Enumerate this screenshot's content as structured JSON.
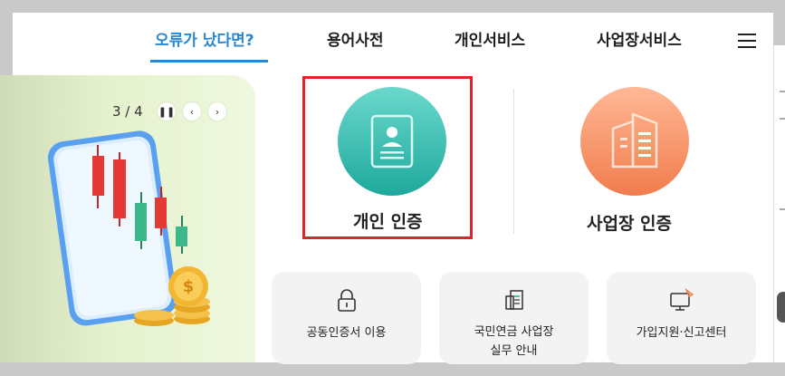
{
  "nav": {
    "items": [
      {
        "label": "오류가 났다면?",
        "active": true
      },
      {
        "label": "용어사전",
        "active": false
      },
      {
        "label": "개인서비스",
        "active": false
      },
      {
        "label": "사업장서비스",
        "active": false
      }
    ],
    "menu_icon": "hamburger-menu-icon"
  },
  "banner": {
    "pager": "3 / 4",
    "controls": [
      "pause-icon",
      "chevron-left-icon",
      "chevron-right-icon"
    ]
  },
  "auth": {
    "personal_label": "개인 인증",
    "business_label": "사업장 인증",
    "personal_icon": "id-card-icon",
    "business_icon": "building-icon"
  },
  "cards": [
    {
      "label": "공동인증서 이용",
      "icon": "lock-icon"
    },
    {
      "label_line1": "국민연금 사업장",
      "label_line2": "실무 안내",
      "icon": "document-icon"
    },
    {
      "label": "가입지원·신고센터",
      "icon": "monitor-cursor-icon"
    }
  ],
  "colors": {
    "accent_blue": "#2a88d2",
    "teal": "#1ea99c",
    "orange": "#f17c4d",
    "highlight_red": "#e02328"
  }
}
